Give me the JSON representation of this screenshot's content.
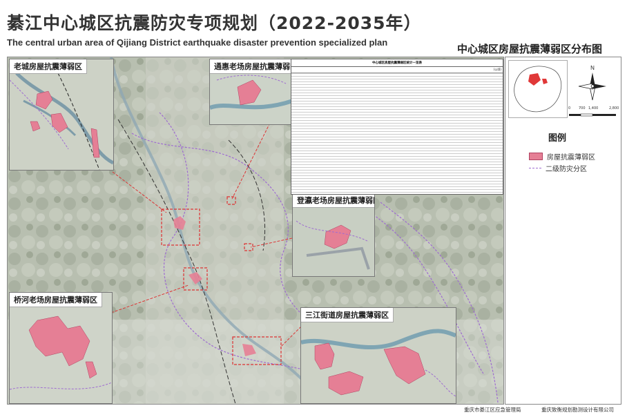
{
  "header": {
    "title_cn": "綦江中心城区抗震防灾专项规划（2022-2035年）",
    "title_en": "The central urban area  of Qijiang District earthquake disaster prevention  specialized plan",
    "subtitle": "中心城区房屋抗震薄弱区分布图"
  },
  "insets": [
    {
      "id": "laocheng",
      "label": "老城房屋抗震薄弱区"
    },
    {
      "id": "tonghui",
      "label": "通惠老场房屋抗震薄弱区"
    },
    {
      "id": "denggao",
      "label": "登瀛老场房屋抗震薄弱区"
    },
    {
      "id": "qiaohe",
      "label": "桥河老场房屋抗震薄弱区"
    },
    {
      "id": "sanjiang",
      "label": "三江街道房屋抗震薄弱区"
    }
  ],
  "stats_table": {
    "title": "中心城区房屋抗震薄弱区统计一览表",
    "col_area": "(公顷)"
  },
  "legend": {
    "title": "图例",
    "items": [
      {
        "label": "房屋抗震薄弱区",
        "color": "#e57f95"
      },
      {
        "label": "二级防灾分区",
        "color": "#9e6bd1"
      }
    ]
  },
  "scale": {
    "labels": [
      "0",
      "700",
      "1,400",
      "2,800"
    ]
  },
  "footer": {
    "org1": "重庆市綦江区应急管理局",
    "org2": "重庆致衡规划勘测设计有限公司"
  }
}
